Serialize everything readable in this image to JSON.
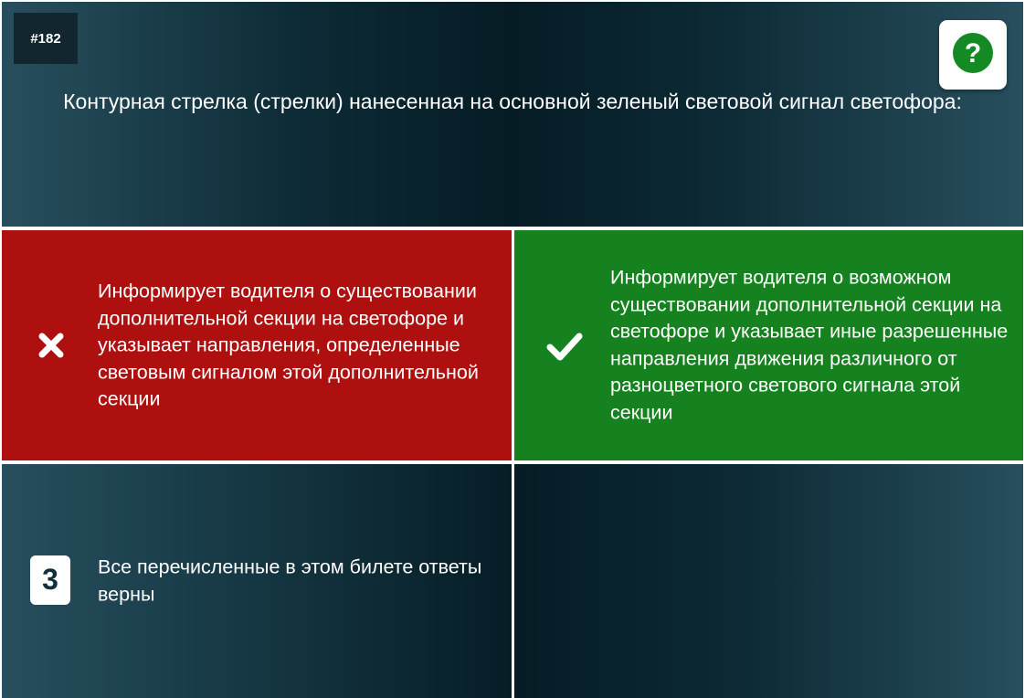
{
  "question": {
    "number": "#182",
    "text": "Контурная стрелка (стрелки) нанесенная на основной зеленый световой сигнал светофора:",
    "help_icon": "question-circle-icon"
  },
  "answers": [
    {
      "status": "wrong",
      "icon": "cross-icon",
      "text": "Информирует водителя о существовании дополнительной секции на светофоре и указывает направления, определенные световым сигналом этой дополнительной секции",
      "color": "#ae1010"
    },
    {
      "status": "correct",
      "icon": "check-icon",
      "text": "Информирует водителя о возможном существовании дополнительной секции на светофоре и указывает иные разрешенные направления движения различного от разноцветного светового сигнала этой секции",
      "color": "#15821f"
    },
    {
      "status": "neutral",
      "number": "3",
      "text": "Все перечисленные в этом билете ответы верны"
    }
  ],
  "colors": {
    "help_green": "#148a25",
    "panel_dark": "#051c25",
    "panel_light": "#284f5e"
  }
}
